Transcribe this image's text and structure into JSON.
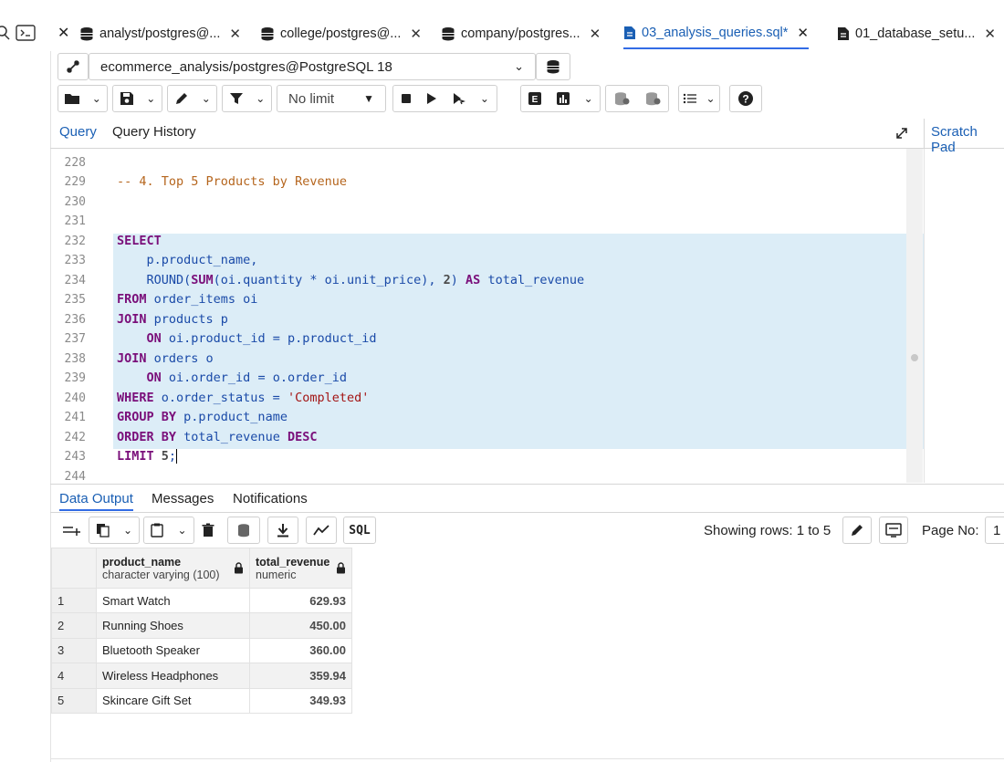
{
  "tabs": [
    {
      "label": "analyst/postgres@...",
      "icon": "database-icon",
      "active": false
    },
    {
      "label": "college/postgres@...",
      "icon": "database-icon",
      "active": false
    },
    {
      "label": "company/postgres...",
      "icon": "database-icon",
      "active": false
    },
    {
      "label": "03_analysis_queries.sql*",
      "icon": "file-icon",
      "active": true
    },
    {
      "label": "01_database_setu...",
      "icon": "file-icon",
      "active": false
    }
  ],
  "connection": {
    "label": "ecommerce_analysis/postgres@PostgreSQL 18"
  },
  "toolbar": {
    "limit_label": "No limit"
  },
  "query_tabs": {
    "query": "Query",
    "history": "Query History",
    "scratch": "Scratch Pad"
  },
  "editor": {
    "lines": [
      "228",
      "229",
      "230",
      "231",
      "232",
      "233",
      "234",
      "235",
      "236",
      "237",
      "238",
      "239",
      "240",
      "241",
      "242",
      "243",
      "244"
    ]
  },
  "output": {
    "tabs": [
      "Data Output",
      "Messages",
      "Notifications"
    ],
    "sql_label": "SQL",
    "showing_rows": "Showing rows: 1 to 5",
    "page_no_label": "Page No:",
    "page_no_value": "1",
    "columns": [
      {
        "name": "product_name",
        "type": "character varying (100)"
      },
      {
        "name": "total_revenue",
        "type": "numeric"
      }
    ],
    "rows": [
      {
        "num": "1",
        "product_name": "Smart Watch",
        "total_revenue": "629.93"
      },
      {
        "num": "2",
        "product_name": "Running Shoes",
        "total_revenue": "450.00"
      },
      {
        "num": "3",
        "product_name": "Bluetooth Speaker",
        "total_revenue": "360.00"
      },
      {
        "num": "4",
        "product_name": "Wireless Headphones",
        "total_revenue": "359.94"
      },
      {
        "num": "5",
        "product_name": "Skincare Gift Set",
        "total_revenue": "349.93"
      }
    ]
  },
  "colors": {
    "accent": "#326ce5",
    "selection": "#dcedf7",
    "keyword": "#7a0f7a",
    "comment": "#b5651d",
    "string": "#a31515"
  }
}
